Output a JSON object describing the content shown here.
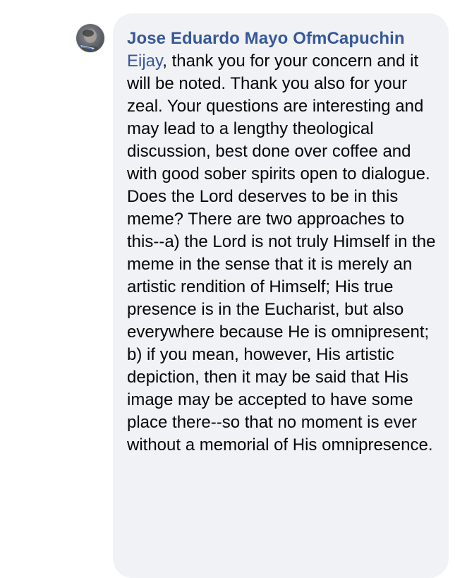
{
  "comment": {
    "author": "Jose Eduardo Mayo OfmCapuchin",
    "mention": "Eijay",
    "body": ", thank you for your concern and it will be noted. Thank you also for your zeal. Your questions are interesting and may lead to a lengthy theological discussion, best done over coffee and with good sober spirits open to dialogue. Does the Lord deserves to be in this meme? There are two approaches to this--a) the Lord is not truly Himself in the meme in the sense that it is merely an artistic rendition of Himself; His true presence is in the Eucharist, but also everywhere because He is omnipresent; b) if you mean, however, His artistic depiction, then it may be said that His image may be accepted to have some place there--so that no moment is ever without a memorial of His omnipresence.",
    "avatar_icon": "profile-photo-icon",
    "colors": {
      "bubble": "#f0f2f5",
      "link": "#385898",
      "text": "#050505"
    }
  }
}
